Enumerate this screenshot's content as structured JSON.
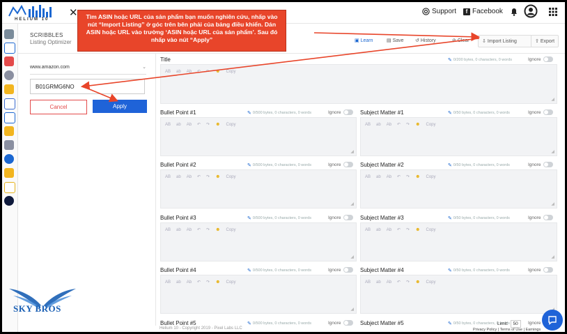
{
  "app": {
    "logo_text": "HELIUM 10",
    "close_symbol": "✕"
  },
  "top_nav": {
    "support_label": "Support",
    "facebook_label": "Facebook"
  },
  "tool": {
    "name": "SCRIBBLES",
    "subtitle": "Listing Optimizer"
  },
  "toolbar": {
    "learn": "Learn",
    "save": "Save",
    "history": "History",
    "clear": "Clear",
    "import": "Import Listing",
    "export": "Export"
  },
  "import_panel": {
    "marketplace": "www.amazon.com",
    "asin_value": "B01GRMG6NO",
    "cancel_label": "Cancel",
    "apply_label": "Apply"
  },
  "title_field": {
    "label": "Title",
    "meta": "0/200 bytes, 0 characters, 0 words",
    "ignore": "Ignore"
  },
  "editor_tools": {
    "ab1": "AB",
    "ab2": "ab",
    "ab3": "Ab",
    "undo": "↶",
    "redo": "↷",
    "smile": "☻",
    "copy": "Copy"
  },
  "bullets": [
    {
      "label": "Bullet Point #1",
      "meta": "0/500 bytes, 0 characters, 0 words",
      "ignore": "Ignore"
    },
    {
      "label": "Bullet Point #2",
      "meta": "0/500 bytes, 0 characters, 0 words",
      "ignore": "Ignore"
    },
    {
      "label": "Bullet Point #3",
      "meta": "0/500 bytes, 0 characters, 0 words",
      "ignore": "Ignore"
    },
    {
      "label": "Bullet Point #4",
      "meta": "0/500 bytes, 0 characters, 0 words",
      "ignore": "Ignore"
    },
    {
      "label": "Bullet Point #5",
      "meta": "0/500 bytes, 0 characters, 0 words",
      "ignore": "Ignore"
    }
  ],
  "subjects": [
    {
      "label": "Subject Matter #1",
      "meta": "0/50 bytes, 0 characters, 0 words",
      "ignore": "Ignore"
    },
    {
      "label": "Subject Matter #2",
      "meta": "0/50 bytes, 0 characters, 0 words",
      "ignore": "Ignore"
    },
    {
      "label": "Subject Matter #3",
      "meta": "0/50 bytes, 0 characters, 0 words",
      "ignore": "Ignore"
    },
    {
      "label": "Subject Matter #4",
      "meta": "0/50 bytes, 0 characters, 0 words",
      "ignore": "Ignore"
    },
    {
      "label": "Subject Matter #5",
      "meta": "0/50 bytes, 0 characters, 0 words",
      "ignore": "Ignore"
    }
  ],
  "footer": {
    "copyright": "Helium 10 - Copyright 2019 - Pixel Labs LLC",
    "limit_label": "Limit:",
    "limit_value": "50",
    "policy": "Privacy Policy | Terms of Use | Earnings"
  },
  "callout": {
    "text": "Tìm ASIN hoặc URL của sản phẩm bạn muốn nghiên cứu, nhấp vào nút “Import Listing” ở góc trên bên phải của bảng điều khiển. Dán ASIN hoặc URL vào trường ‘ASIN hoặc URL của sản phẩm’. Sau đó nhấp vào nút “Apply”"
  },
  "watermark": {
    "text": "SKY BROS"
  },
  "colors": {
    "accent": "#1f63d8",
    "callout": "#e8452a",
    "cancel": "#e34a4a"
  }
}
